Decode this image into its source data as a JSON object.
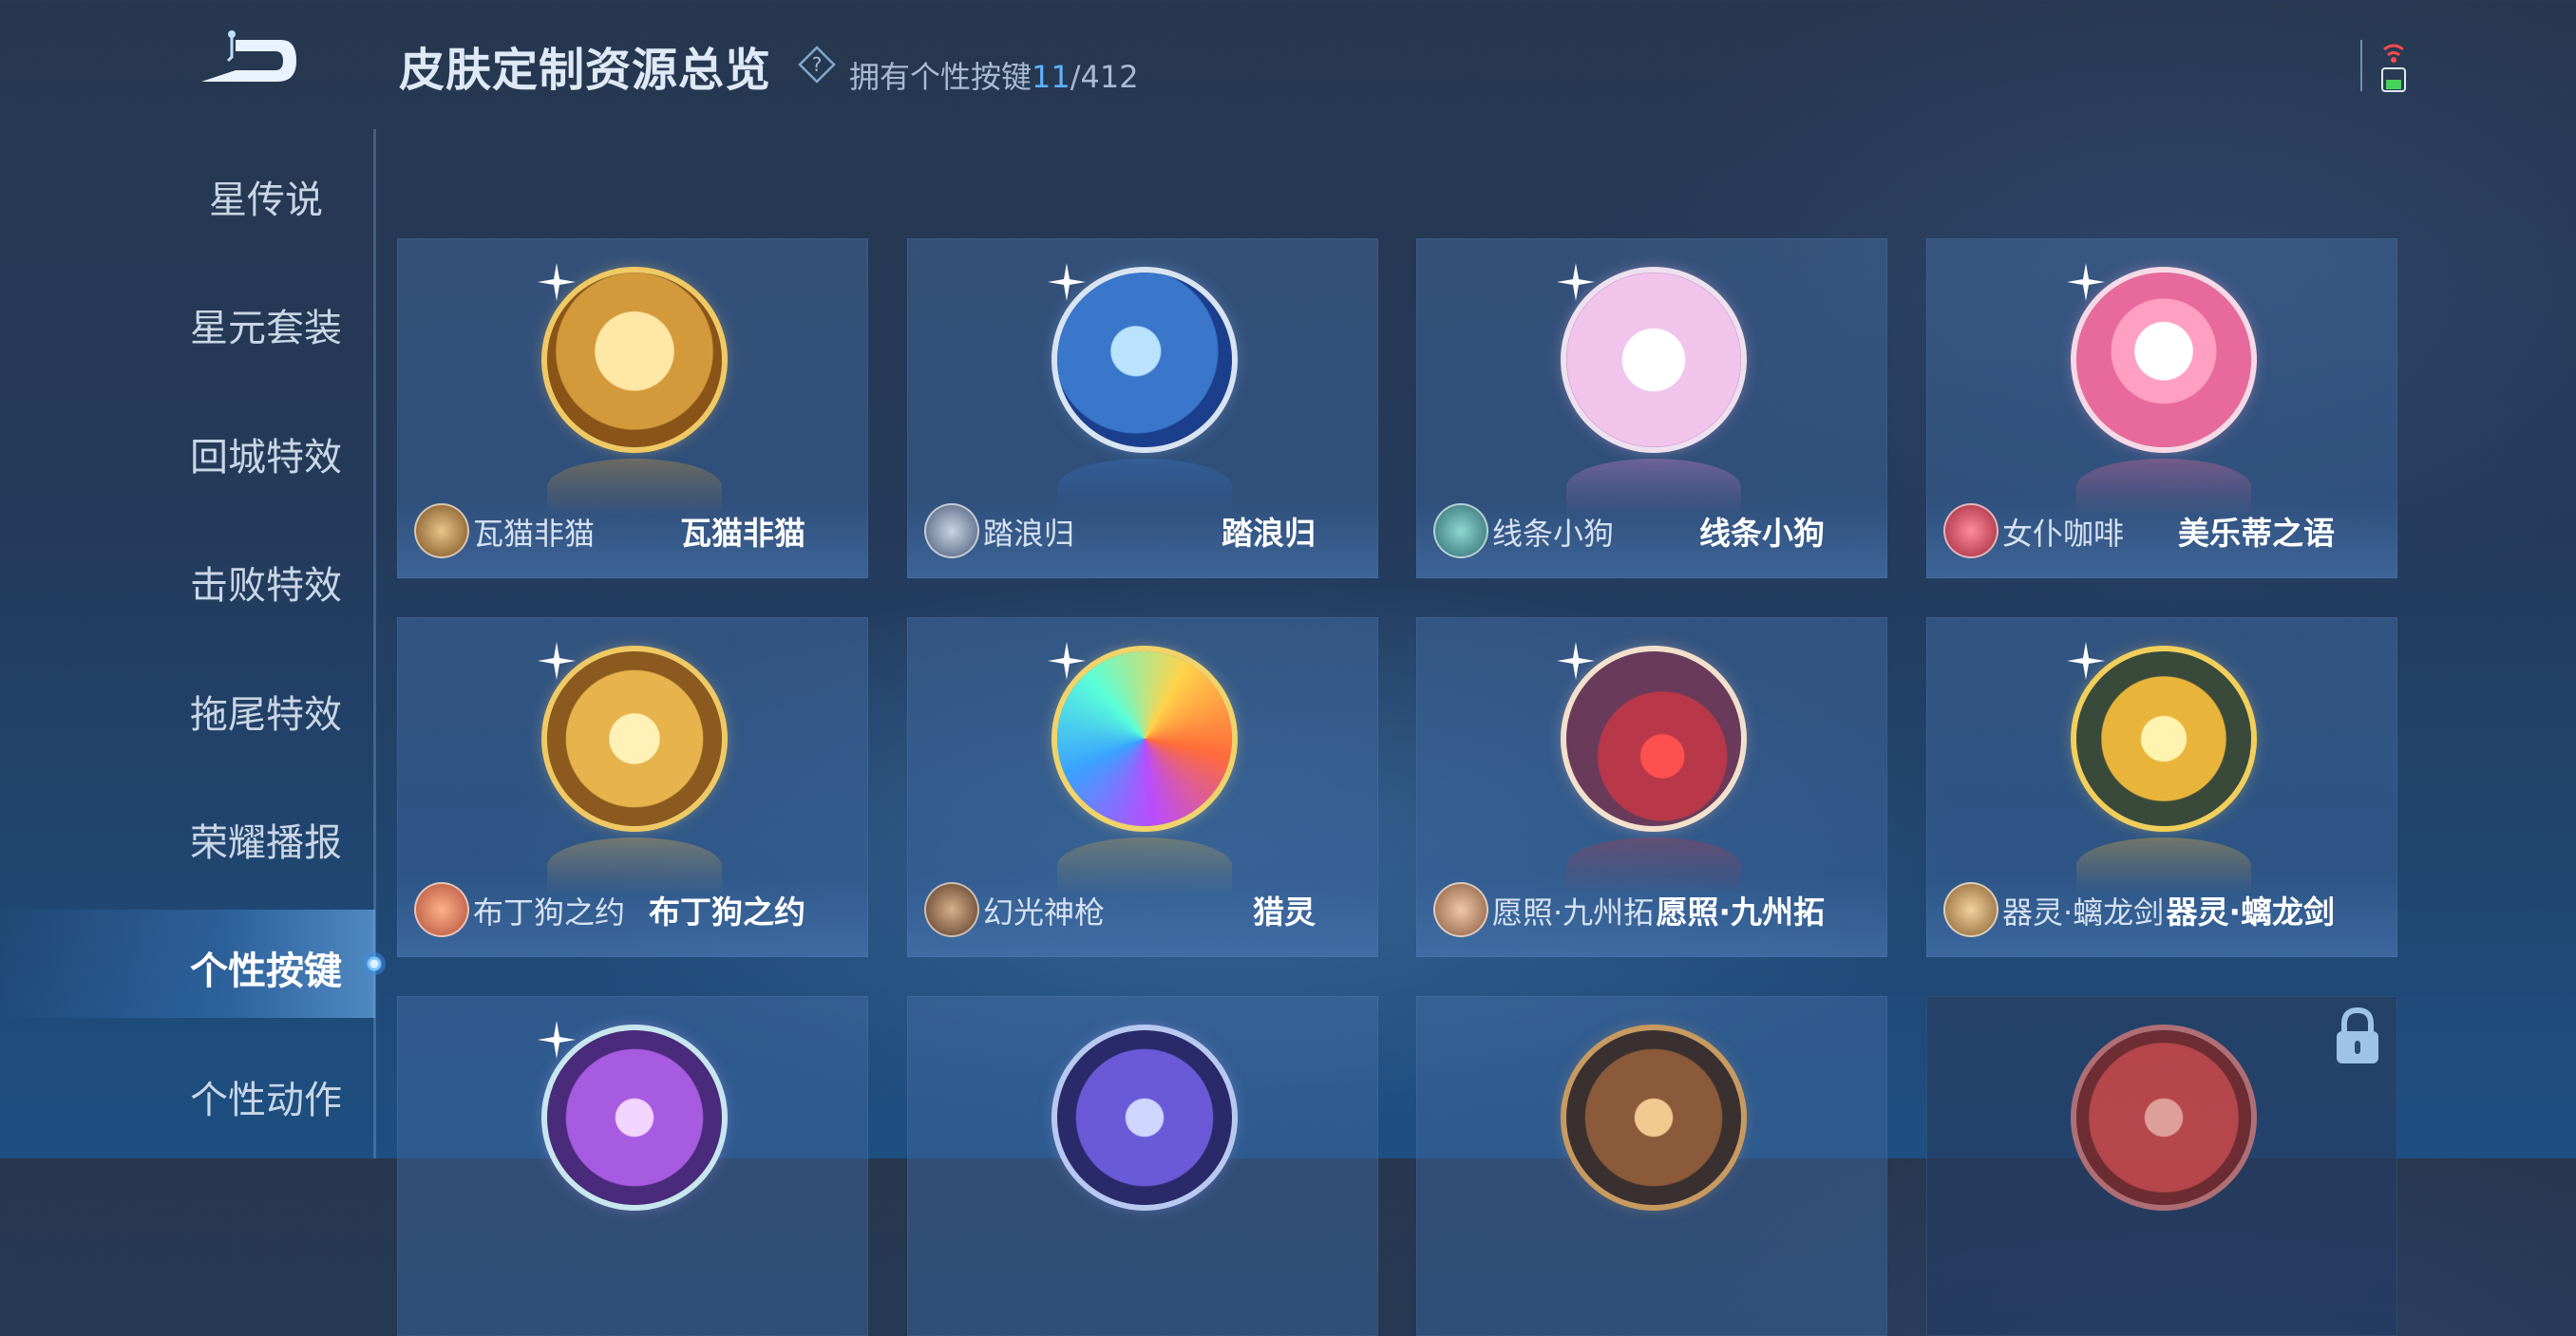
{
  "header": {
    "title": "皮肤定制资源总览",
    "owned_prefix": "拥有个性按键",
    "owned_count": "11",
    "owned_total": "/412"
  },
  "sidebar": {
    "items": [
      {
        "label": "星传说"
      },
      {
        "label": "星元套装"
      },
      {
        "label": "回城特效"
      },
      {
        "label": "击败特效"
      },
      {
        "label": "拖尾特效"
      },
      {
        "label": "荣耀播报"
      },
      {
        "label": "个性按键",
        "active": true
      },
      {
        "label": "个性动作"
      }
    ]
  },
  "cards": [
    {
      "hero": "瓦猫非猫",
      "skin": "瓦猫非猫",
      "theme": "gold-mask"
    },
    {
      "hero": "踏浪归",
      "skin": "踏浪归",
      "theme": "blue-spear"
    },
    {
      "hero": "线条小狗",
      "skin": "线条小狗",
      "theme": "pink-dog"
    },
    {
      "hero": "女仆咖啡",
      "skin": "美乐蒂之语",
      "theme": "melody"
    },
    {
      "hero": "布丁狗之约",
      "skin": "布丁狗之约",
      "theme": "gold-ribbon"
    },
    {
      "hero": "幻光神枪",
      "skin": "猎灵",
      "theme": "rainbow-spear"
    },
    {
      "hero": "愿照·九州拓",
      "skin": "愿照·九州拓",
      "theme": "red-blade"
    },
    {
      "hero": "器灵·螭龙剑",
      "skin": "器灵·螭龙剑",
      "theme": "gold-sword"
    },
    {
      "theme": "purple-flower"
    },
    {
      "theme": "violet-blade"
    },
    {
      "theme": "bronze-sword"
    },
    {
      "theme": "red-locked",
      "locked": true
    }
  ],
  "colors": {
    "accent": "#5fb1ff",
    "background": "#243a5a",
    "card": "#3b5f92"
  },
  "icons": {
    "back": "back-arrow-icon",
    "help": "question-diamond-icon",
    "signal": "signal-battery-icon",
    "lock": "lock-icon"
  }
}
